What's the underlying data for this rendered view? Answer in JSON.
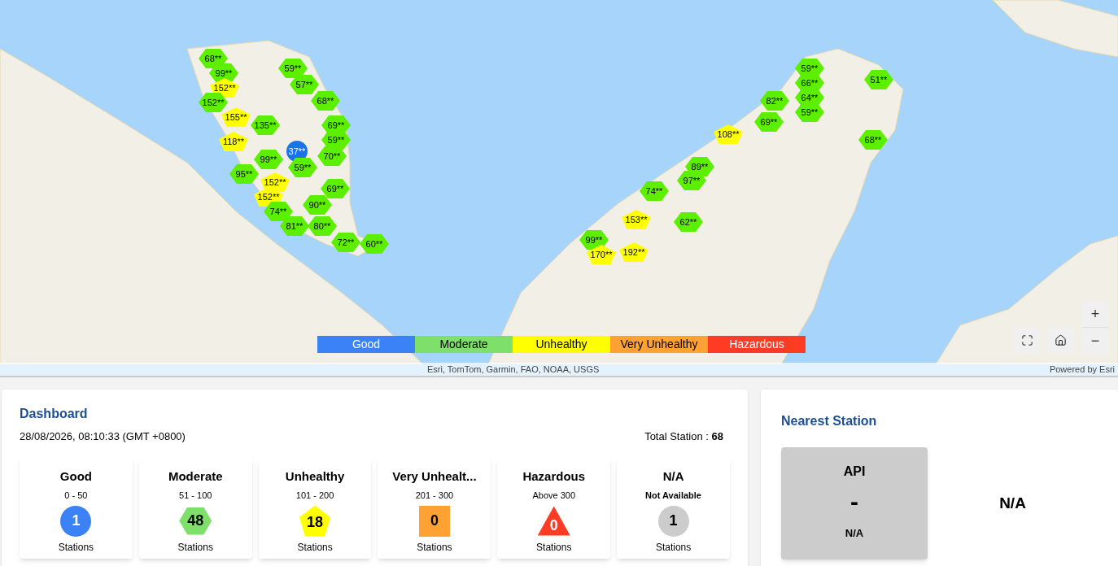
{
  "map": {
    "markers": [
      {
        "label": "68**",
        "kind": "hexagon",
        "color": "#5cf000"
      },
      {
        "label": "99**",
        "kind": "hexagon",
        "color": "#5cf000"
      },
      {
        "label": "152**",
        "kind": "pentagon",
        "color": "#ffff00"
      },
      {
        "label": "152**",
        "kind": "hexagon",
        "color": "#5cf000"
      },
      {
        "label": "155**",
        "kind": "pentagon",
        "color": "#ffff00"
      },
      {
        "label": "135**",
        "kind": "hexagon",
        "color": "#5cf000"
      },
      {
        "label": "118**",
        "kind": "pentagon",
        "color": "#ffff00"
      },
      {
        "label": "59**",
        "kind": "hexagon",
        "color": "#5cf000"
      },
      {
        "label": "57**",
        "kind": "hexagon",
        "color": "#5cf000"
      },
      {
        "label": "68**",
        "kind": "hexagon",
        "color": "#5cf000"
      },
      {
        "label": "69**",
        "kind": "hexagon",
        "color": "#5cf000"
      },
      {
        "label": "59**",
        "kind": "hexagon",
        "color": "#5cf000"
      },
      {
        "label": "70**",
        "kind": "hexagon",
        "color": "#5cf000"
      },
      {
        "label": "37**",
        "kind": "circle",
        "color": "#1a73e8"
      },
      {
        "label": "59**",
        "kind": "hexagon",
        "color": "#5cf000"
      },
      {
        "label": "99**",
        "kind": "hexagon",
        "color": "#5cf000"
      },
      {
        "label": "95**",
        "kind": "hexagon",
        "color": "#5cf000"
      },
      {
        "label": "152**",
        "kind": "pentagon",
        "color": "#ffff00"
      },
      {
        "label": "152**",
        "kind": "pentagon",
        "color": "#ffff00"
      },
      {
        "label": "69**",
        "kind": "hexagon",
        "color": "#5cf000"
      },
      {
        "label": "74**",
        "kind": "hexagon",
        "color": "#5cf000"
      },
      {
        "label": "90**",
        "kind": "hexagon",
        "color": "#5cf000"
      },
      {
        "label": "81**",
        "kind": "hexagon",
        "color": "#5cf000"
      },
      {
        "label": "80**",
        "kind": "hexagon",
        "color": "#5cf000"
      },
      {
        "label": "72**",
        "kind": "hexagon",
        "color": "#5cf000"
      },
      {
        "label": "60**",
        "kind": "hexagon",
        "color": "#5cf000"
      },
      {
        "label": "59**",
        "kind": "hexagon",
        "color": "#5cf000"
      },
      {
        "label": "66**",
        "kind": "hexagon",
        "color": "#5cf000"
      },
      {
        "label": "64**",
        "kind": "hexagon",
        "color": "#5cf000"
      },
      {
        "label": "59**",
        "kind": "hexagon",
        "color": "#5cf000"
      },
      {
        "label": "51**",
        "kind": "hexagon",
        "color": "#5cf000"
      },
      {
        "label": "82**",
        "kind": "hexagon",
        "color": "#5cf000"
      },
      {
        "label": "69**",
        "kind": "hexagon",
        "color": "#5cf000"
      },
      {
        "label": "108**",
        "kind": "pentagon",
        "color": "#ffff00"
      },
      {
        "label": "68**",
        "kind": "hexagon",
        "color": "#5cf000"
      },
      {
        "label": "89**",
        "kind": "hexagon",
        "color": "#5cf000"
      },
      {
        "label": "97**",
        "kind": "hexagon",
        "color": "#5cf000"
      },
      {
        "label": "74**",
        "kind": "hexagon",
        "color": "#5cf000"
      },
      {
        "label": "153**",
        "kind": "pentagon",
        "color": "#ffff00"
      },
      {
        "label": "62**",
        "kind": "hexagon",
        "color": "#5cf000"
      },
      {
        "label": "99**",
        "kind": "hexagon",
        "color": "#5cf000"
      },
      {
        "label": "170**",
        "kind": "pentagon",
        "color": "#ffff00"
      },
      {
        "label": "192**",
        "kind": "pentagon",
        "color": "#ffff00"
      }
    ],
    "legend": [
      {
        "label": "Good",
        "color": "#3b82f6"
      },
      {
        "label": "Moderate",
        "color": "#7ee06a"
      },
      {
        "label": "Unhealthy",
        "color": "#ffff00"
      },
      {
        "label": "Very Unhealthy",
        "color": "#ffa233"
      },
      {
        "label": "Hazardous",
        "color": "#ff3b24"
      }
    ],
    "zoom_in": "+",
    "zoom_out": "−",
    "attribution": "Esri, TomTom, Garmin, FAO, NOAA, USGS",
    "powered_by": "Powered by Esri"
  },
  "dashboard": {
    "title": "Dashboard",
    "datetime": "28/08/2026, 08:10:33 (GMT +0800)",
    "total_label": "Total Station :",
    "total_value": "68",
    "cards": [
      {
        "name": "Good",
        "range": "0 - 50",
        "range_bold": false,
        "count": "1",
        "kind": "circle",
        "color": "#3b82f6",
        "unit": "Stations"
      },
      {
        "name": "Moderate",
        "range": "51 - 100",
        "range_bold": false,
        "count": "48",
        "kind": "hexagon",
        "color": "#7ee06a",
        "unit": "Stations"
      },
      {
        "name": "Unhealthy",
        "range": "101 - 200",
        "range_bold": false,
        "count": "18",
        "kind": "pentagon",
        "color": "#ffff00",
        "unit": "Stations"
      },
      {
        "name": "Very Unhealt...",
        "range": "201 - 300",
        "range_bold": false,
        "count": "0",
        "kind": "square",
        "color": "#ffa233",
        "unit": "Stations"
      },
      {
        "name": "Hazardous",
        "range": "Above 300",
        "range_bold": false,
        "count": "0",
        "kind": "triangle",
        "color": "#ff3b24",
        "unit": "Stations"
      },
      {
        "name": "N/A",
        "range": "Not Available",
        "range_bold": true,
        "count": "1",
        "kind": "circle",
        "color": "#cccccc",
        "unit": "Stations"
      }
    ]
  },
  "nearest": {
    "title": "Nearest Station",
    "api_label": "API",
    "api_value": "-",
    "api_status": "N/A",
    "station": "N/A"
  }
}
